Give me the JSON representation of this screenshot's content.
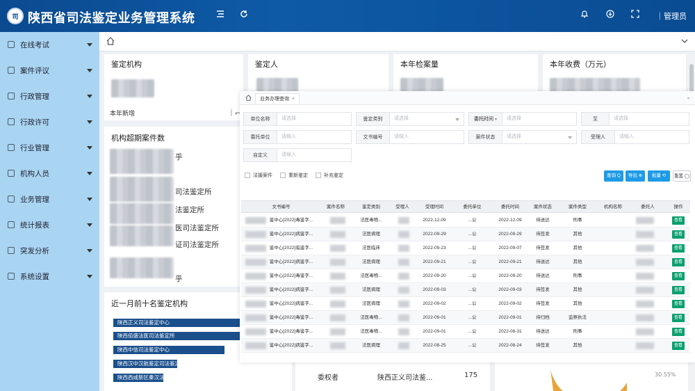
{
  "header": {
    "logo_text": "司",
    "title": "陕西省司法鉴定业务管理系统",
    "user": "｜管理员",
    "icons": [
      "menu-fold-icon",
      "refresh-icon",
      "bell-icon",
      "download-icon",
      "fullscreen-icon"
    ]
  },
  "sidebar": {
    "items": [
      {
        "label": "在线考试",
        "icon": "book-icon"
      },
      {
        "label": "案件评议",
        "icon": "clipboard-icon"
      },
      {
        "label": "行政管理",
        "icon": "building-icon"
      },
      {
        "label": "行政许可",
        "icon": "license-icon"
      },
      {
        "label": "行业管理",
        "icon": "grid-icon"
      },
      {
        "label": "机构人员",
        "icon": "user-icon"
      },
      {
        "label": "业务管理",
        "icon": "briefcase-icon"
      },
      {
        "label": "统计报表",
        "icon": "report-icon"
      },
      {
        "label": "突发分析",
        "icon": "alert-icon"
      },
      {
        "label": "系统设置",
        "icon": "settings-icon"
      }
    ]
  },
  "cards": [
    {
      "title": "鉴定机构"
    },
    {
      "title": "鉴定人"
    },
    {
      "title": "本年检案量"
    },
    {
      "title": "本年收费（万元）"
    }
  ],
  "card1_footer": "本年新增",
  "panel_left": {
    "title": "机构超期案件数",
    "partials": [
      "乎",
      "司法鉴定所",
      "法鉴定所",
      "医司法鉴定所",
      "证司法鉴定所",
      "乎"
    ]
  },
  "panel_rank": {
    "title": "近一月前十名鉴定机构",
    "bars": [
      "陕西正义司法鉴定中心",
      "陕西佰盛法医司法鉴定所",
      "陕西中信司法鉴定中心",
      "陕西汉中汉航鉴定司法鉴定",
      "陕西西咸新区秦汉法医司法鉴定"
    ]
  },
  "modal": {
    "tab_label": "业务办理查询",
    "form": {
      "fields": [
        {
          "label": "单位名称",
          "placeholder": "请选择",
          "select": false
        },
        {
          "label": "鉴定类别",
          "placeholder": "请选择",
          "select": true
        },
        {
          "label": "委托时间",
          "placeholder": "请选择",
          "select": true
        },
        {
          "label": "至",
          "placeholder": "请选择",
          "select": false
        },
        {
          "label": "委托单位",
          "placeholder": "请输入",
          "select": false
        },
        {
          "label": "文书编号",
          "placeholder": "请输入",
          "select": false
        },
        {
          "label": "案件状态",
          "placeholder": "请选择",
          "select": true
        },
        {
          "label": "受理人",
          "placeholder": "请输入",
          "select": false
        },
        {
          "label": "自定义",
          "placeholder": "请输入",
          "select": false
        }
      ],
      "checkboxes": [
        "法援案件",
        "重新鉴定",
        "补充鉴定"
      ],
      "buttons": {
        "query": "查询 Q",
        "export": "导出 ⊕",
        "reset": "批量 ⟲",
        "clear": "重置 ◯"
      }
    },
    "table": {
      "headers": [
        "文书编号",
        "案件名称",
        "鉴定类别",
        "受理人",
        "受理时间",
        "委托单位",
        "委托时间",
        "案件状态",
        "案件类型",
        "机构名称",
        "委托人",
        "操作"
      ],
      "view_label": "查看",
      "rows": [
        {
          "doc": "鉴中心[2022]毒鉴字...",
          "cat": "法医毒物...",
          "date1": "2022-12-09",
          "unit": "...公",
          "date2": "2022-12-09",
          "status": "待送达",
          "type": "刑事"
        },
        {
          "doc": "鉴中心[2022]病鉴字...",
          "cat": "法医病理",
          "date1": "2022-09-29",
          "unit": "...公",
          "date2": "2022-09-29",
          "status": "待签发",
          "type": "其他"
        },
        {
          "doc": "鉴中心[2022]临鉴字...",
          "cat": "法医临床",
          "date1": "2022-09-23",
          "unit": "...公",
          "date2": "2022-09-07",
          "status": "待签发",
          "type": "其他"
        },
        {
          "doc": "鉴中心[2022]病鉴字...",
          "cat": "法医病理",
          "date1": "2022-09-21",
          "unit": "...公",
          "date2": "2022-09-21",
          "status": "待送达",
          "type": "其他"
        },
        {
          "doc": "鉴中心[2022]毒鉴字...",
          "cat": "法医毒物...",
          "date1": "2022-09-20",
          "unit": "...公",
          "date2": "2022-09-20",
          "status": "待送达",
          "type": "刑事"
        },
        {
          "doc": "鉴中心[2022]病鉴字...",
          "cat": "法医病理",
          "date1": "2022-09-03",
          "unit": "...公",
          "date2": "2022-09-03",
          "status": "待签发",
          "type": "其他"
        },
        {
          "doc": "鉴中心[2022]病鉴字...",
          "cat": "法医病理",
          "date1": "2022-09-02",
          "unit": "...公",
          "date2": "2022-09-02",
          "status": "待签发",
          "type": "其他"
        },
        {
          "doc": "鉴中心[2022]毒鉴字...",
          "cat": "法医毒物...",
          "date1": "2022-09-01",
          "unit": "...公",
          "date2": "2022-09-01",
          "status": "待归档",
          "type": "监察执法"
        },
        {
          "doc": "鉴中心[2022]毒鉴字...",
          "cat": "法医毒物...",
          "date1": "2022-09-01",
          "unit": "...公",
          "date2": "2022-08-31",
          "status": "待送达",
          "type": "刑事"
        },
        {
          "doc": "鉴中心[2022]病鉴字...",
          "cat": "法医病理",
          "date1": "2022-08-25",
          "unit": "...公",
          "date2": "2022-08-24",
          "status": "待签发",
          "type": "其他"
        }
      ]
    }
  },
  "bottom": {
    "left_text": "委权者",
    "mid_text": "陕西正义司法鉴...",
    "count": "175",
    "pct": "30.55%"
  }
}
